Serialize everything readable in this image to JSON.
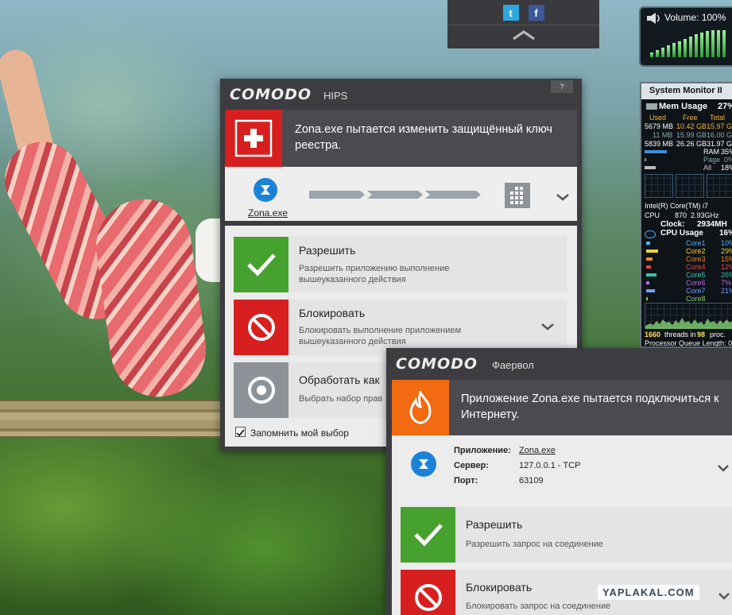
{
  "social": {
    "twitter": "twitter-icon",
    "facebook": "facebook-icon"
  },
  "volume": {
    "label": "Volume: 100%",
    "level": 1.0
  },
  "sysmon": {
    "title": "System Monitor II",
    "mem_label": "Mem Usage",
    "mem_pct": "27%",
    "hdr_used": "Used",
    "hdr_free": "Free",
    "hdr_total": "Total",
    "r1_used": "5679 MB",
    "r1_free": "10.42 GB",
    "r1_total": "15.97 G",
    "r2_used": "11 MB",
    "r2_free": "15.99 GB",
    "r2_total": "16.00 G",
    "r3_used": "5839 MB",
    "r3_free": "26.26 GB",
    "r3_total": "31.97 G",
    "ram": "RAM",
    "ram_pct": "35%",
    "page": "Page",
    "page_pct": "0%",
    "all": "All",
    "all_pct": "18%",
    "cpu_name": "Intel(R) Core(TM) i7",
    "cpu_label": "CPU",
    "cpu_mhz": "870",
    "cpu_ghz": "2.93GHz",
    "clock_label": "Clock:",
    "clock_val": "2934MH",
    "cpu_usage_label": "CPU Usage",
    "cpu_usage_pct": "16%",
    "cores": [
      {
        "name": "Core1",
        "pct": "10%",
        "color": "#4fb3ff"
      },
      {
        "name": "Core2",
        "pct": "29%",
        "color": "#f2d03a"
      },
      {
        "name": "Core3",
        "pct": "15%",
        "color": "#f08a2c"
      },
      {
        "name": "Core4",
        "pct": "12%",
        "color": "#e04848"
      },
      {
        "name": "Core5",
        "pct": "26%",
        "color": "#36c4a6"
      },
      {
        "name": "Core6",
        "pct": "7%",
        "color": "#b56ce0"
      },
      {
        "name": "Core7",
        "pct": "21%",
        "color": "#6fa0ff"
      },
      {
        "name": "Core8",
        "pct": "",
        "color": "#8ac46a"
      }
    ],
    "threads": "1660",
    "threads_mid": "threads in",
    "procs": "98",
    "procs_suffix": "proc.",
    "queue": "Processor Queue Length: 0"
  },
  "hips": {
    "brand": "COMODO",
    "subtitle": "HIPS",
    "help": "?",
    "message": "Zona.exe пытается изменить защищённый ключ реестра.",
    "app_name": "Zona.exe",
    "allow_title": "Разрешить",
    "allow_desc": "Разрешить приложению выполнение вышеуказанного действия",
    "block_title": "Блокировать",
    "block_desc": "Блокировать выполнение приложением вышеуказанного действия",
    "treat_title": "Обработать как",
    "treat_desc": "Выбрать набор прав",
    "remember": "Запомнить мой выбор",
    "accent": "#d71f1f"
  },
  "firewall": {
    "brand": "COMODO",
    "subtitle": "Фаервол",
    "message": "Приложение Zona.exe пытается подключиться к Интернету.",
    "app_label": "Приложение:",
    "app_value": "Zona.exe",
    "server_label": "Сервер:",
    "server_value": "127.0.0.1 - TCP",
    "port_label": "Порт:",
    "port_value": "63109",
    "allow_title": "Разрешить",
    "allow_desc": "Разрешить запрос на соединение",
    "block_title": "Блокировать",
    "block_desc": "Блокировать запрос на соединение",
    "accent": "#f26a12"
  },
  "watermark": "YAPLAKAL.COM"
}
